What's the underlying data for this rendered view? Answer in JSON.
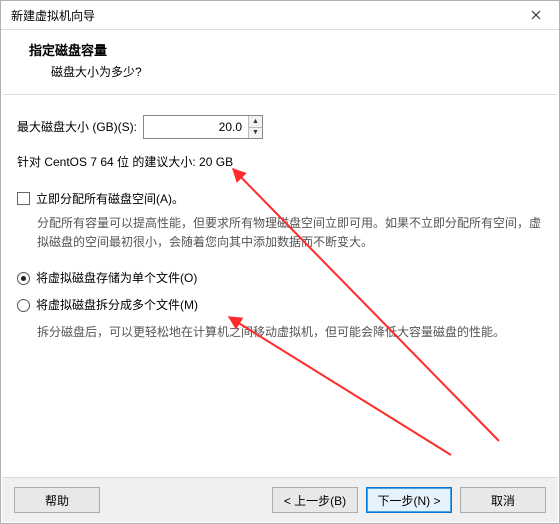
{
  "window": {
    "title": "新建虚拟机向导",
    "heading": "指定磁盘容量",
    "subheading": "磁盘大小为多少?"
  },
  "disk": {
    "size_label": "最大磁盘大小 (GB)(S):",
    "size_value": "20.0",
    "recommend_prefix": "针对 CentOS 7 64 位 的建议大小: ",
    "recommend_value": "20 GB"
  },
  "allocate": {
    "checkbox_label": "立即分配所有磁盘空间(A)。",
    "explain": "分配所有容量可以提高性能，但要求所有物理磁盘空间立即可用。如果不立即分配所有空间，虚拟磁盘的空间最初很小，会随着您向其中添加数据而不断变大。",
    "checked": false
  },
  "storage": {
    "option_single": "将虚拟磁盘存储为单个文件(O)",
    "option_split": "将虚拟磁盘拆分成多个文件(M)",
    "split_explain": "拆分磁盘后，可以更轻松地在计算机之间移动虚拟机，但可能会降低大容量磁盘的性能。",
    "selected": "single"
  },
  "buttons": {
    "help": "帮助",
    "back": "< 上一步(B)",
    "next": "下一步(N) >",
    "cancel": "取消"
  }
}
